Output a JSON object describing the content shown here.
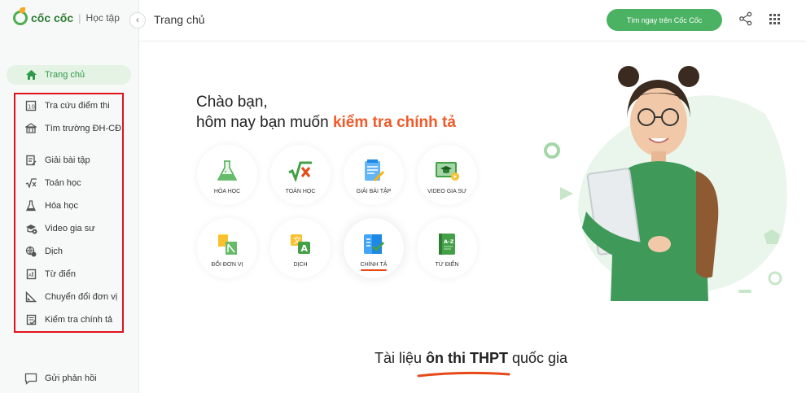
{
  "brand": {
    "name": "cốc cốc",
    "sub": "Học tập"
  },
  "sidebar": {
    "active": {
      "label": "Trang chủ",
      "icon": "home-icon"
    },
    "items": [
      {
        "label": "Tra cứu điểm thi",
        "icon": "exam-score-icon"
      },
      {
        "label": "Tìm trường ĐH-CĐ",
        "icon": "university-icon"
      },
      {
        "label": "Giải bài tập",
        "icon": "homework-icon"
      },
      {
        "label": "Toán học",
        "icon": "sqrt-icon"
      },
      {
        "label": "Hóa học",
        "icon": "flask-icon"
      },
      {
        "label": "Video gia sư",
        "icon": "video-tutor-icon"
      },
      {
        "label": "Dịch",
        "icon": "translate-icon"
      },
      {
        "label": "Từ điển",
        "icon": "dictionary-icon"
      },
      {
        "label": "Chuyển đổi đơn vị",
        "icon": "unit-convert-icon"
      },
      {
        "label": "Kiểm tra chính tả",
        "icon": "spell-check-icon"
      }
    ],
    "feedback": {
      "label": "Gửi phản hồi",
      "icon": "feedback-icon"
    }
  },
  "header": {
    "title": "Trang chủ",
    "search_button": "Tìm ngay trên Cốc Cốc"
  },
  "greeting": {
    "line1": "Chào bạn,",
    "line2_prefix": "hôm nay bạn muốn ",
    "line2_highlight": "kiểm tra chính tả"
  },
  "tiles": [
    {
      "label": "HÓA HỌC",
      "icon": "flask-icon"
    },
    {
      "label": "TOÁN HỌC",
      "icon": "sqrt-icon"
    },
    {
      "label": "GIẢI BÀI TẬP",
      "icon": "homework-icon"
    },
    {
      "label": "VIDEO GIA SƯ",
      "icon": "video-tutor-icon"
    },
    {
      "label": "ĐỔI ĐƠN VỊ",
      "icon": "unit-convert-icon"
    },
    {
      "label": "DỊCH",
      "icon": "translate-icon"
    },
    {
      "label": "CHÍNH TẢ",
      "icon": "spell-check-icon"
    },
    {
      "label": "TỪ ĐIỂN",
      "icon": "dictionary-icon"
    }
  ],
  "bottom": {
    "prefix": "Tài liệu ",
    "bold": "ôn thi THPT",
    "suffix": " quốc gia"
  },
  "colors": {
    "brand_green": "#4cb263",
    "accent_orange": "#f05a28",
    "highlight_red": "#e0121c"
  }
}
